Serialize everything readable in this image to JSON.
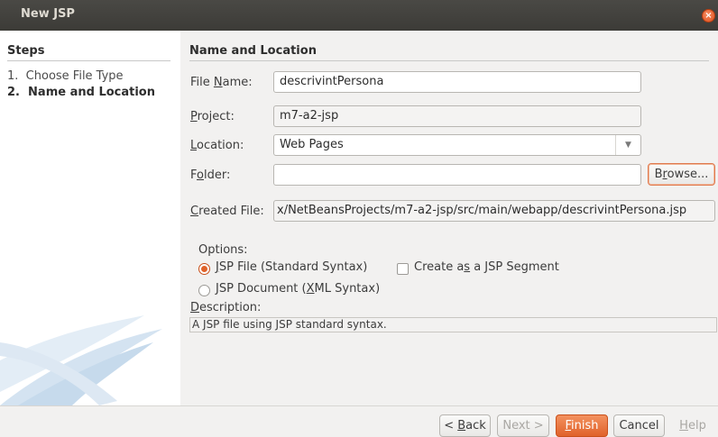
{
  "window": {
    "title": "New JSP",
    "close_glyph": "×"
  },
  "steps": {
    "header": "Steps",
    "items": [
      {
        "num": "1.",
        "label": "Choose File Type",
        "current": false
      },
      {
        "num": "2.",
        "label": "Name and Location",
        "current": true
      }
    ]
  },
  "panel": {
    "header": "Name and Location"
  },
  "form": {
    "file_name": {
      "label_pre": "File ",
      "label_mn": "N",
      "label_post": "ame:",
      "value": "descrivintPersona"
    },
    "project": {
      "label_pre": "",
      "label_mn": "P",
      "label_post": "roject:",
      "value": "m7-a2-jsp"
    },
    "location": {
      "label_pre": "",
      "label_mn": "L",
      "label_post": "ocation:",
      "value": "Web Pages"
    },
    "folder": {
      "label_pre": "F",
      "label_mn": "o",
      "label_post": "lder:",
      "value": ""
    },
    "browse": {
      "pre": "B",
      "mn": "r",
      "post": "owse..."
    },
    "created_file": {
      "label_pre": "",
      "label_mn": "C",
      "label_post": "reated File:",
      "value": "x/NetBeansProjects/m7-a2-jsp/src/main/webapp/descrivintPersona.jsp"
    }
  },
  "options": {
    "label": "Options:",
    "jsp_file": {
      "pre": "",
      "mn": "J",
      "post": "SP File (Standard Syntax)",
      "selected": true
    },
    "segment": {
      "pre": "Create a",
      "mn": "s",
      "post": " a JSP Segment",
      "checked": false
    },
    "jsp_document": {
      "pre": "JSP Document (",
      "mn": "X",
      "post": "ML Syntax)",
      "selected": false
    },
    "description_label": {
      "pre": "",
      "mn": "D",
      "post": "escription:"
    },
    "description": "A JSP file using JSP standard syntax."
  },
  "buttons": {
    "back": {
      "pre": "< ",
      "mn": "B",
      "post": "ack"
    },
    "next": "Next >",
    "finish": {
      "pre": "",
      "mn": "F",
      "post": "inish"
    },
    "cancel": "Cancel",
    "help": {
      "pre": "",
      "mn": "H",
      "post": "elp"
    }
  },
  "colors": {
    "accent": "#e0622a",
    "titlebar": "#3c3b37",
    "background": "#f2f1f0"
  }
}
